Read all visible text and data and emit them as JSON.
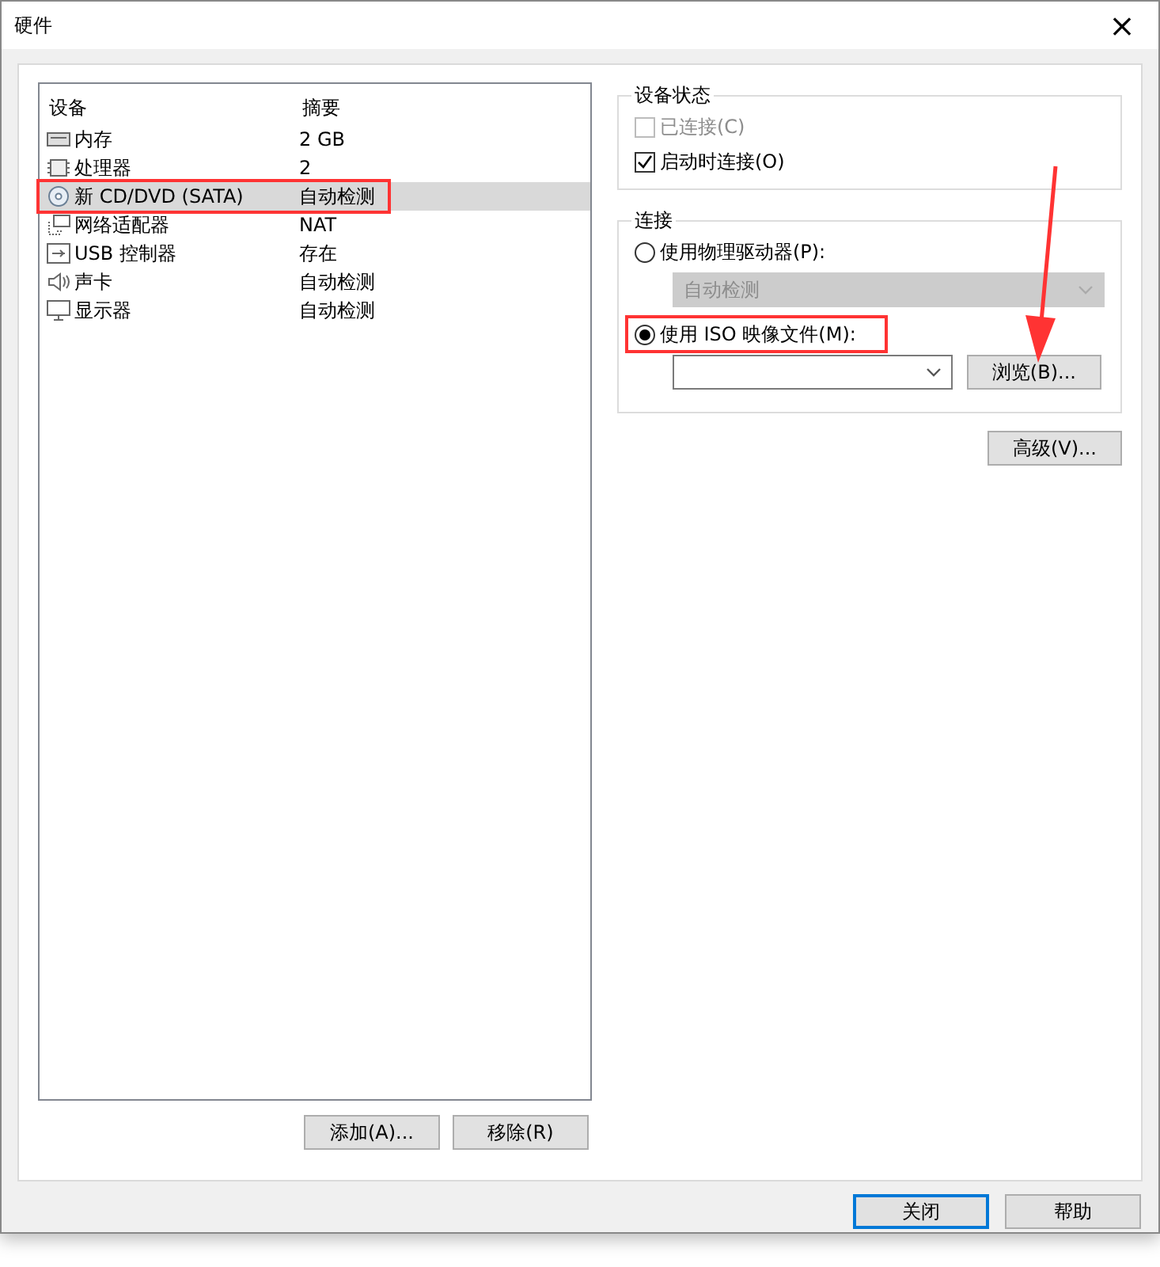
{
  "window": {
    "title": "硬件",
    "close": "×"
  },
  "devices": {
    "columns": [
      "设备",
      "摘要"
    ],
    "rows": [
      {
        "kind": "memory",
        "name": "内存",
        "summary": "2 GB",
        "selected": false,
        "highlighted": false
      },
      {
        "kind": "cpu",
        "name": "处理器",
        "summary": "2",
        "selected": false,
        "highlighted": false
      },
      {
        "kind": "disc",
        "name": "新 CD/DVD (SATA)",
        "summary": "自动检测",
        "selected": true,
        "highlighted": true
      },
      {
        "kind": "network",
        "name": "网络适配器",
        "summary": "NAT",
        "selected": false,
        "highlighted": false
      },
      {
        "kind": "usb",
        "name": "USB 控制器",
        "summary": "存在",
        "selected": false,
        "highlighted": false
      },
      {
        "kind": "sound",
        "name": "声卡",
        "summary": "自动检测",
        "selected": false,
        "highlighted": false
      },
      {
        "kind": "display",
        "name": "显示器",
        "summary": "自动检测",
        "selected": false,
        "highlighted": false
      }
    ],
    "buttons": [
      "添加(A)...",
      "移除(R)"
    ]
  },
  "device_status": {
    "title": "设备状态",
    "checkboxes": [
      {
        "label": "已连接(C)",
        "checked": false,
        "disabled": true
      },
      {
        "label": "启动时连接(O)",
        "checked": true,
        "disabled": false
      }
    ]
  },
  "connection": {
    "title": "连接",
    "options": [
      {
        "label": "使用物理驱动器(P):",
        "selected": false,
        "highlighted": false
      },
      {
        "label": "使用 ISO 映像文件(M):",
        "selected": true,
        "highlighted": true
      }
    ],
    "drive_select": {
      "value": "自动检测",
      "disabled": true
    },
    "iso_select": {
      "disabled": false
    },
    "browse_button": "浏览(B)...",
    "arrow_to_browse": true
  },
  "advanced_button": "高级(V)...",
  "footer_buttons": [
    {
      "label": "关闭",
      "default": true
    },
    {
      "label": "帮助",
      "default": false
    }
  ]
}
